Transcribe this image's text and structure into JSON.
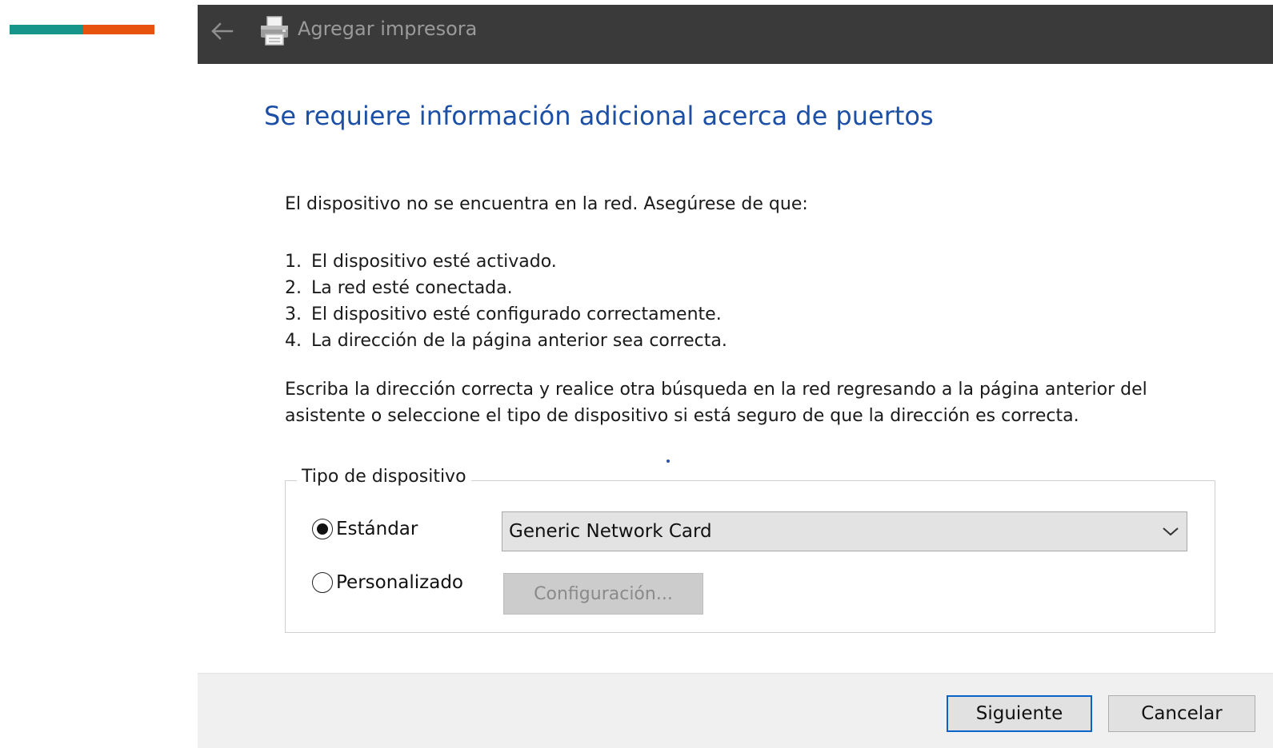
{
  "accent": {
    "colors": [
      "#16958a",
      "#e8520f"
    ]
  },
  "window": {
    "title": "Agregar impresora",
    "titlebar_color": "#3a3a3a",
    "back_icon": "back-arrow-icon",
    "app_icon": "printer-icon"
  },
  "page": {
    "heading": "Se requiere información adicional acerca de puertos",
    "heading_color": "#1c4fa6",
    "intro": "El dispositivo no se encuentra en la red. Asegúrese de que:",
    "steps": [
      {
        "num": "1.",
        "text": "El dispositivo esté activado."
      },
      {
        "num": "2.",
        "text": "La red esté conectada."
      },
      {
        "num": "3.",
        "text": "El dispositivo esté configurado correctamente."
      },
      {
        "num": "4.",
        "text": "La dirección de la página anterior sea correcta."
      }
    ],
    "instructions": "Escriba la dirección correcta y realice otra búsqueda en la red regresando a la página anterior del asistente o seleccione el tipo de dispositivo si está seguro de que la dirección es correcta."
  },
  "device_type": {
    "legend": "Tipo de dispositivo",
    "standard_label": "Estándar",
    "standard_selected": true,
    "standard_value": "Generic Network Card",
    "custom_label": "Personalizado",
    "custom_selected": false,
    "settings_button": "Configuración..."
  },
  "footer": {
    "next_label": "Siguiente",
    "cancel_label": "Cancelar",
    "next_border_color": "#0a64c8"
  }
}
